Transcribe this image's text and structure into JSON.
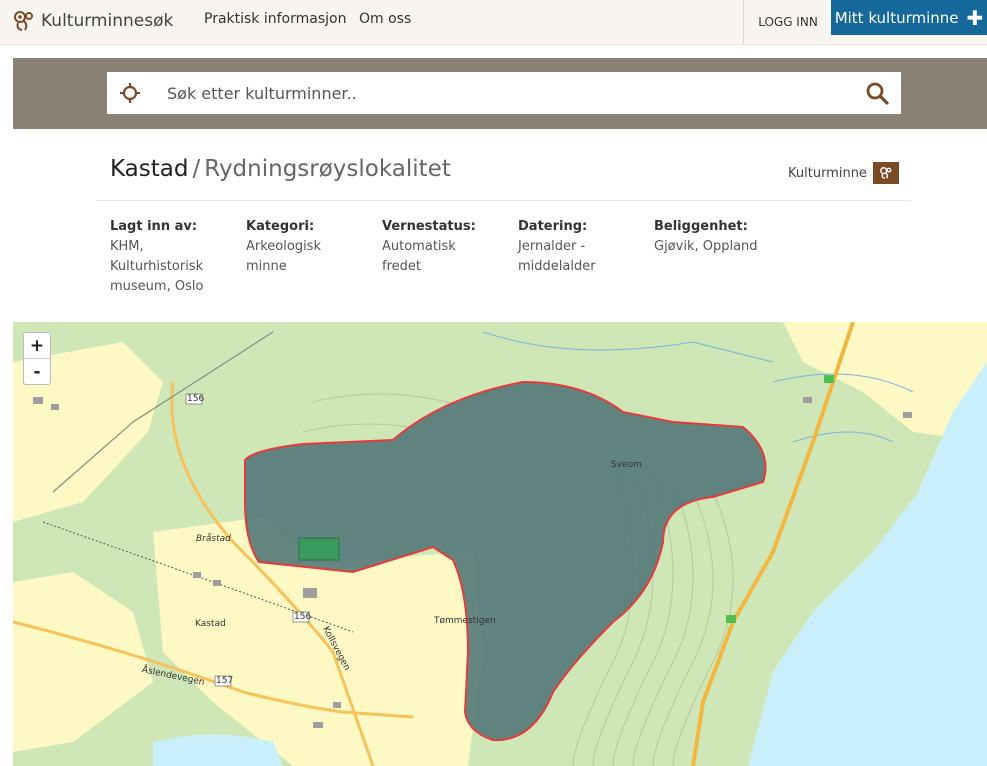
{
  "nav": {
    "brand": "Kulturminnesøk",
    "links": [
      "Praktisk informasjon",
      "Om oss"
    ],
    "login": "LOGG INN",
    "my_button": "Mitt kulturminne",
    "my_button_icon": "plus-icon"
  },
  "search": {
    "placeholder": "Søk etter kulturminner..",
    "locate_icon": "crosshair-icon",
    "search_icon": "search-icon"
  },
  "record": {
    "name": "Kastad",
    "separator": "/",
    "type": "Rydningsrøyslokalitet",
    "badge_label": "Kulturminne",
    "badge_icon": "kulturminne-icon"
  },
  "meta": [
    {
      "label": "Lagt inn av:",
      "lines": [
        "KHM,",
        "Kulturhistorisk",
        "museum, Oslo"
      ]
    },
    {
      "label": "Kategori:",
      "lines": [
        "Arkeologisk",
        "minne"
      ]
    },
    {
      "label": "Vernestatus:",
      "lines": [
        "Automatisk",
        "fredet"
      ]
    },
    {
      "label": "Datering:",
      "lines": [
        "Jernalder -",
        "middelalder"
      ]
    },
    {
      "label": "Beliggenhet:",
      "lines": [
        "Gjøvik, Oppland"
      ]
    }
  ],
  "map": {
    "zoom_in": "+",
    "zoom_out": "-",
    "labels": [
      "Bråstad",
      "Kastad",
      "Sveom",
      "Tømmestigen",
      "Kollsvegen",
      "Åslendevegen",
      "156",
      "157"
    ],
    "colors": {
      "field": "#fdf8c4",
      "forest": "#cfe7b6",
      "water": "#c9f0fa",
      "polygon": "#54787a",
      "outline": "#e33b3b"
    }
  },
  "colors": {
    "accent": "#14689a",
    "brand_brown": "#7a4b26",
    "search_band": "#8a8176"
  }
}
